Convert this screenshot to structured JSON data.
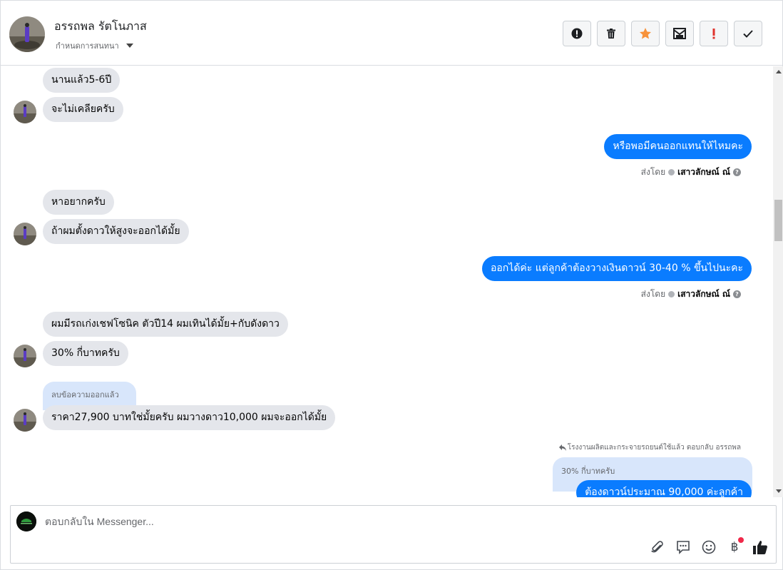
{
  "header": {
    "contact_name": "อรรถพล รัตโนภาส",
    "settings_label": "กำหนดการสนทนา",
    "actions": [
      {
        "name": "report-button",
        "icon": "alert-circle-icon"
      },
      {
        "name": "delete-button",
        "icon": "trash-icon"
      },
      {
        "name": "star-button",
        "icon": "star-icon"
      },
      {
        "name": "mark-unread-button",
        "icon": "envelope-icon"
      },
      {
        "name": "spam-button",
        "icon": "exclamation-icon"
      },
      {
        "name": "done-button",
        "icon": "checkmark-icon"
      }
    ]
  },
  "messages": {
    "m1": "นานแล้ว5-6ปี",
    "m2": "จะไม่เคลียครับ",
    "m3": "หรือพอมีคนออกแทนให้ไหมคะ",
    "m4": "หาอยากครับ",
    "m5": "ถ้าผมตั้งดาวให้สูงจะออกได้มั้ย",
    "m6": "ออกได้ค่ะ แต่ลูกค้าต้องวางเงินดาวน์ 30-40 % ขึ้นไปนะคะ",
    "m7": "ผมมีรถเก่งเชฟโซนิค ตัวปี14 ผมเทินได้มั้ย+กับดังดาว",
    "m8": "30% กี่บาทครับ",
    "m9": "ราคา27,900 บาทใช่มั้ยครับ ผมวางดาว10,000 ผมจะออกได้มั้ย",
    "m10": "ต้องดาวน์ประมาณ 90,000 ค่ะลูกค้า"
  },
  "sent_by": {
    "prefix": "ส่งโดย",
    "agent": "เสาวลักษณ์ ณ์",
    "help": "?"
  },
  "deleted_label": "ลบข้อความออกแล้ว",
  "reply": {
    "meta": "โรงงานผลิตและกระจายรถยนต์ใช้แล้ว ตอบกลับ อรรถพล",
    "quote": "30% กี่บาทครับ"
  },
  "composer": {
    "placeholder": "ตอบกลับใน Messenger...",
    "tools": [
      "paperclip-icon",
      "chat-bubble-icon",
      "smiley-icon",
      "baht-icon",
      "thumbs-up-icon"
    ],
    "baht_symbol": "฿"
  }
}
